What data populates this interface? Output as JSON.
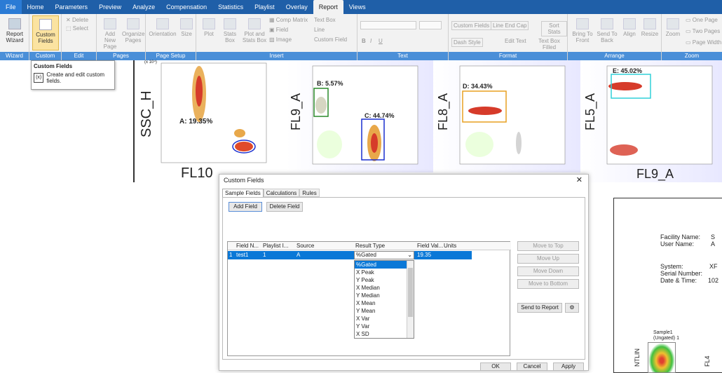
{
  "menu": [
    "File",
    "Home",
    "Parameters",
    "Preview",
    "Analyze",
    "Compensation",
    "Statistics",
    "Playlist",
    "Overlay",
    "Report",
    "Views"
  ],
  "ribbon": {
    "wizard": {
      "btn": "Report Wizard",
      "group": "Wizard"
    },
    "custom": {
      "btn": "Custom Fields",
      "group": "Custom Fields"
    },
    "edit": {
      "delete": "Delete",
      "select": "Select",
      "group": "Edit"
    },
    "pages": {
      "add": "Add New Page",
      "organize": "Organize Pages",
      "group": "Pages"
    },
    "setup": {
      "orientation": "Orientation",
      "size": "Size",
      "group": "Page Setup"
    },
    "insert": {
      "plot": "Plot",
      "stats": "Stats Box",
      "plotstats": "Plot and Stats Box",
      "comp": "Comp Matrix",
      "field": "Field",
      "image": "Image",
      "textbox": "Text Box",
      "line": "Line",
      "customfield": "Custom Field",
      "group": "Insert"
    },
    "text": {
      "group": "Text",
      "b": "B",
      "i": "I",
      "u": "U"
    },
    "format": {
      "cf": "Custom Fields",
      "lec": "Line End Cap",
      "sort": "Sort Stats",
      "dash": "Dash Style",
      "edit": "Edit Text",
      "filled": "Text Box Filled",
      "group": "Format"
    },
    "arrange": {
      "front": "Bring To Front",
      "back": "Send To Back",
      "align": "Align",
      "resize": "Resize",
      "group": "Arrange"
    },
    "zoom": {
      "zoom": "Zoom",
      "one": "One Page",
      "two": "Two Pages",
      "width": "Page Width",
      "group": "Zoom"
    }
  },
  "tooltip": {
    "title": "Custom Fields",
    "body": "Create and edit custom fields."
  },
  "plots": [
    {
      "ylabel": "SSC_H",
      "xlabel": "FL10",
      "gate": "A: 19.35%",
      "scale": "(x 10⁴)"
    },
    {
      "ylabel": "FL9_A",
      "gates": [
        "B: 5.57%",
        "C: 44.74%"
      ]
    },
    {
      "ylabel": "FL8_A",
      "gates": [
        "D: 34.43%"
      ]
    },
    {
      "ylabel": "FL5_A",
      "xlabel": "FL9_A",
      "gates": [
        "E: 45.02%"
      ]
    }
  ],
  "dialog": {
    "title": "Custom Fields",
    "tabs": [
      "Sample Fields",
      "Calculations",
      "Rules"
    ],
    "add": "Add Field",
    "delete": "Delete Field",
    "cols": [
      "Field N...",
      "Playlist I...",
      "Source",
      "Result Type",
      "Field Val...",
      "Units"
    ],
    "row": {
      "idx": "1",
      "name": "test1",
      "playlist": "1",
      "source": "A",
      "result": "%Gated",
      "value": "19.35"
    },
    "options": [
      "%Gated",
      "X Peak",
      "Y Peak",
      "X Median",
      "Y Median",
      "X Mean",
      "Y Mean",
      "X Var",
      "Y Var",
      "X SD"
    ],
    "side": [
      "Move to Top",
      "Move Up",
      "Move Down",
      "Move to Bottom"
    ],
    "send": "Send to Report",
    "ok": "OK",
    "cancel": "Cancel",
    "apply": "Apply"
  },
  "report": {
    "facility": "Facility Name:",
    "user": "User Name:",
    "system": "System:",
    "serial": "Serial Number:",
    "datetime": "Date & Time:",
    "f_val": "S",
    "u_val": "A",
    "s_val": "XF",
    "d_val": "102",
    "sample": "Sample1",
    "sub": "(Ungated) 1",
    "ylab1": "NTLIN",
    "ylab2": "FL4"
  }
}
